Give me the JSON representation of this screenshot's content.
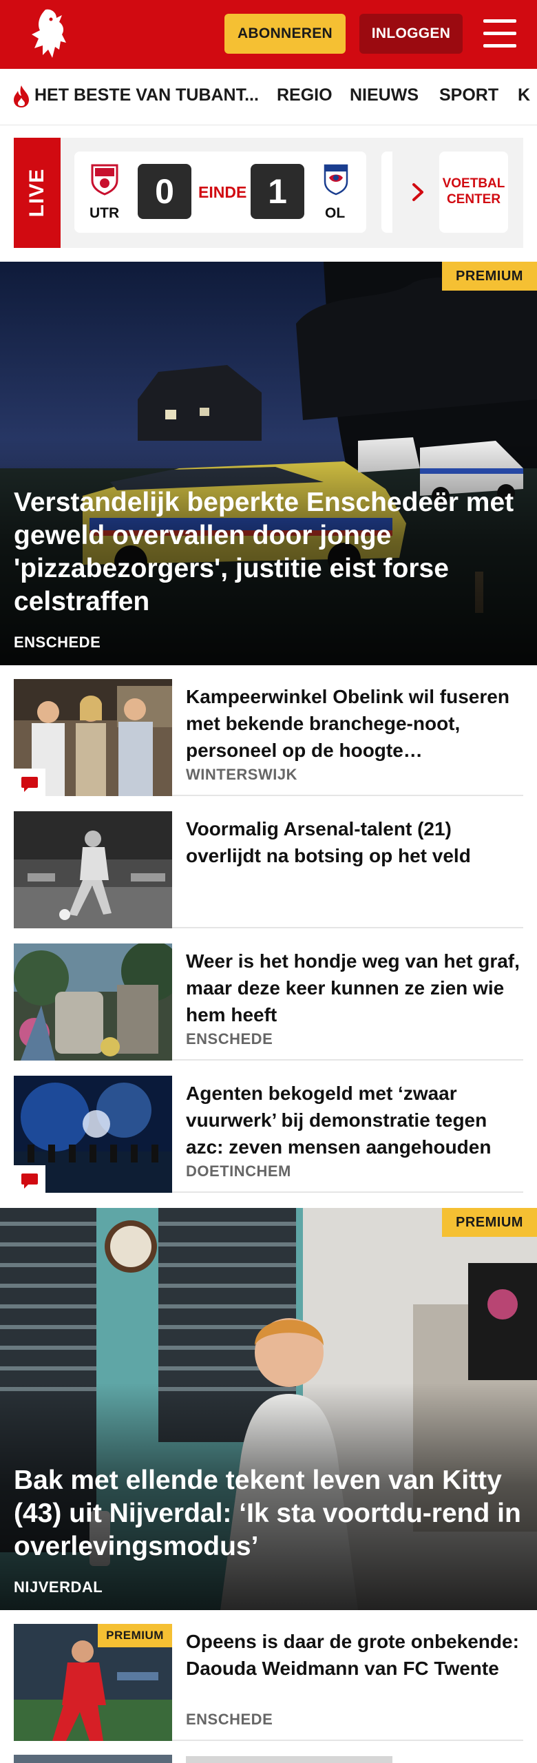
{
  "header": {
    "logo": "tubantia-horse-logo",
    "subscribe_label": "ABONNEREN",
    "login_label": "INLOGGEN",
    "menu_icon": "hamburger-menu-icon",
    "colors": {
      "brand_red": "#d10a11",
      "accent_yellow": "#f5c033",
      "login_dark_red": "#9b0a10"
    }
  },
  "nav": {
    "items": [
      {
        "label": "HET BESTE VAN TUBANT...",
        "icon": "flame-icon"
      },
      {
        "label": "REGIO"
      },
      {
        "label": "NIEUWS"
      },
      {
        "label": "SPORT"
      },
      {
        "label": "K"
      }
    ]
  },
  "live": {
    "label": "LIVE",
    "match": {
      "home_team": "UTR",
      "home_score": "0",
      "status": "EINDE",
      "away_score": "1",
      "away_team": "OL"
    },
    "voetbal_center": "VOETBAL CENTER"
  },
  "hero1": {
    "badge": "PREMIUM",
    "title": "Verstandelijk beperkte Enschedeër met geweld overvallen door jonge 'pizzabezorgers', justitie eist forse celstraffen",
    "location": "ENSCHEDE"
  },
  "articles": [
    {
      "title": "Kampeerwinkel Obelink wil fuseren met bekende branchege-noot, personeel op de hoogte…",
      "location": "WINTERSWIJK",
      "comments": true
    },
    {
      "title": "Voormalig Arsenal-talent (21) overlijdt na botsing op het veld",
      "location": "",
      "comments": false
    },
    {
      "title": "Weer is het hondje weg van het graf, maar deze keer kunnen ze zien wie hem heeft",
      "location": "ENSCHEDE",
      "comments": false
    },
    {
      "title": "Agenten bekogeld met ‘zwaar vuurwerk’ bij demonstratie tegen azc: zeven mensen aangehouden",
      "location": "DOETINCHEM",
      "comments": true
    }
  ],
  "hero2": {
    "badge": "PREMIUM",
    "title": "Bak met ellende tekent leven van Kitty (43) uit Nijverdal: ‘Ik sta voortdu-rend in overlevingsmodus’",
    "location": "NIJVERDAL"
  },
  "article_last": {
    "badge": "PREMIUM",
    "title": "Opeens is daar de grote onbekende: Daouda Weidmann van FC Twente",
    "location": "ENSCHEDE"
  }
}
